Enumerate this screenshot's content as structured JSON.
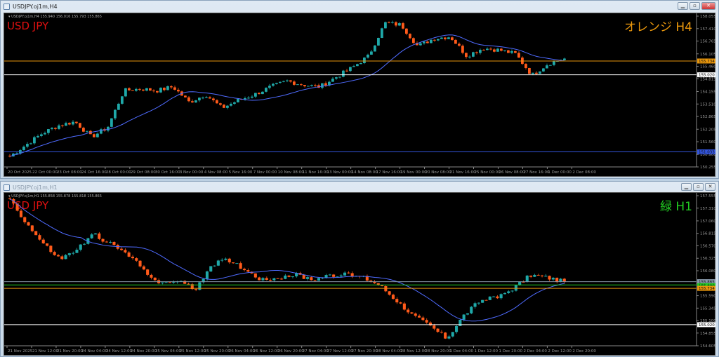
{
  "windows": [
    {
      "title": "USDJPY.oj1m,H4",
      "header": "▾ USDJPY.oj1m,H4  155.940 156.016 155.793 155.865",
      "symbol_label": "USD JPY",
      "tf_label": "オレンジ H4",
      "tf_color": "#e8960c",
      "active": true
    },
    {
      "title": "USDJPY.oj1m,H1",
      "header": "▾ USDJPY.oj1m,H1  155.858 155.878 155.818 155.865",
      "symbol_label": "USD JPY",
      "tf_label": "緑 H1",
      "tf_color": "#22cc22",
      "active": false
    }
  ],
  "colors": {
    "bull": "#1fa8a8",
    "bear": "#ff5a1a",
    "ma": "#4f6bff",
    "symbol": "#e01010"
  },
  "chart_data": [
    {
      "type": "candlestick",
      "ylim": [
        150.255,
        158.055
      ],
      "yticks": [
        "158.055",
        "157.410",
        "156.765",
        "156.105",
        "155.460",
        "154.815",
        "154.155",
        "153.510",
        "152.865",
        "152.205",
        "151.560",
        "150.900",
        "150.255"
      ],
      "xticks": [
        "20 Oct 2025",
        "22 Oct 00:00",
        "23 Oct 08:00",
        "24 Oct 16:00",
        "28 Oct 00:00",
        "29 Oct 08:00",
        "30 Oct 16:00",
        "3 Nov 00:00",
        "4 Nov 08:00",
        "5 Nov 16:00",
        "7 Nov 00:00",
        "10 Nov 08:00",
        "11 Nov 16:00",
        "13 Nov 00:00",
        "14 Nov 08:00",
        "17 Nov 16:00",
        "19 Nov 00:00",
        "20 Nov 08:00",
        "21 Nov 16:00",
        "25 Nov 00:00",
        "26 Nov 08:00",
        "27 Nov 16:00",
        "1 Dec 00:00",
        "2 Dec 08:00"
      ],
      "hlines": [
        {
          "price": 155.734,
          "label": "155.734",
          "color": "#e8960c"
        },
        {
          "price": 155.02,
          "label": "155.020",
          "color": "#ffffff"
        },
        {
          "price": 151.033,
          "label": "151.033",
          "color": "#3355dd"
        }
      ],
      "path": [
        150.8,
        151.4,
        152.0,
        152.4,
        152.6,
        151.8,
        152.3,
        154.2,
        154.3,
        154.2,
        154.4,
        153.6,
        154.0,
        153.3,
        153.7,
        154.0,
        154.4,
        154.7,
        154.5,
        154.4,
        154.9,
        155.4,
        156.0,
        157.7,
        157.6,
        156.5,
        156.9,
        157.0,
        156.0,
        156.4,
        156.3,
        156.1,
        155.0,
        155.6,
        155.86
      ]
    },
    {
      "type": "candlestick",
      "ylim": [
        154.605,
        157.555
      ],
      "yticks": [
        "157.555",
        "157.310",
        "157.060",
        "156.815",
        "156.570",
        "156.325",
        "156.080",
        "155.835",
        "155.590",
        "155.345",
        "155.100",
        "154.855",
        "154.605"
      ],
      "xticks": [
        "21 Nov 2025",
        "21 Nov 12:00",
        "21 Nov 20:00",
        "24 Nov 04:00",
        "24 Nov 12:00",
        "24 Nov 20:00",
        "25 Nov 04:00",
        "25 Nov 12:00",
        "25 Nov 20:00",
        "26 Nov 04:00",
        "26 Nov 12:00",
        "26 Nov 20:00",
        "27 Nov 04:00",
        "27 Nov 12:00",
        "27 Nov 20:00",
        "28 Nov 04:00",
        "28 Nov 12:00",
        "28 Nov 20:00",
        "1 Dec 04:00",
        "1 Dec 12:00",
        "1 Dec 20:00",
        "2 Dec 04:00",
        "2 Dec 12:00",
        "2 Dec 20:00"
      ],
      "hlines": [
        {
          "price": 155.865,
          "label": "155.865",
          "color": "#8899aa"
        },
        {
          "price": 155.8,
          "label": "155.800",
          "color": "#22cc22"
        },
        {
          "price": 155.734,
          "label": "155.734",
          "color": "#e8960c"
        },
        {
          "price": 155.02,
          "label": "155.020",
          "color": "#ffffff"
        }
      ],
      "path": [
        157.5,
        157.0,
        156.6,
        156.3,
        156.5,
        156.8,
        156.6,
        156.4,
        156.1,
        155.8,
        155.9,
        155.7,
        156.2,
        156.3,
        156.1,
        155.9,
        155.95,
        156.0,
        155.9,
        156.0,
        156.0,
        155.95,
        155.8,
        155.5,
        155.2,
        155.0,
        154.75,
        155.2,
        155.5,
        155.55,
        155.75,
        156.0,
        155.95,
        155.865
      ]
    }
  ]
}
